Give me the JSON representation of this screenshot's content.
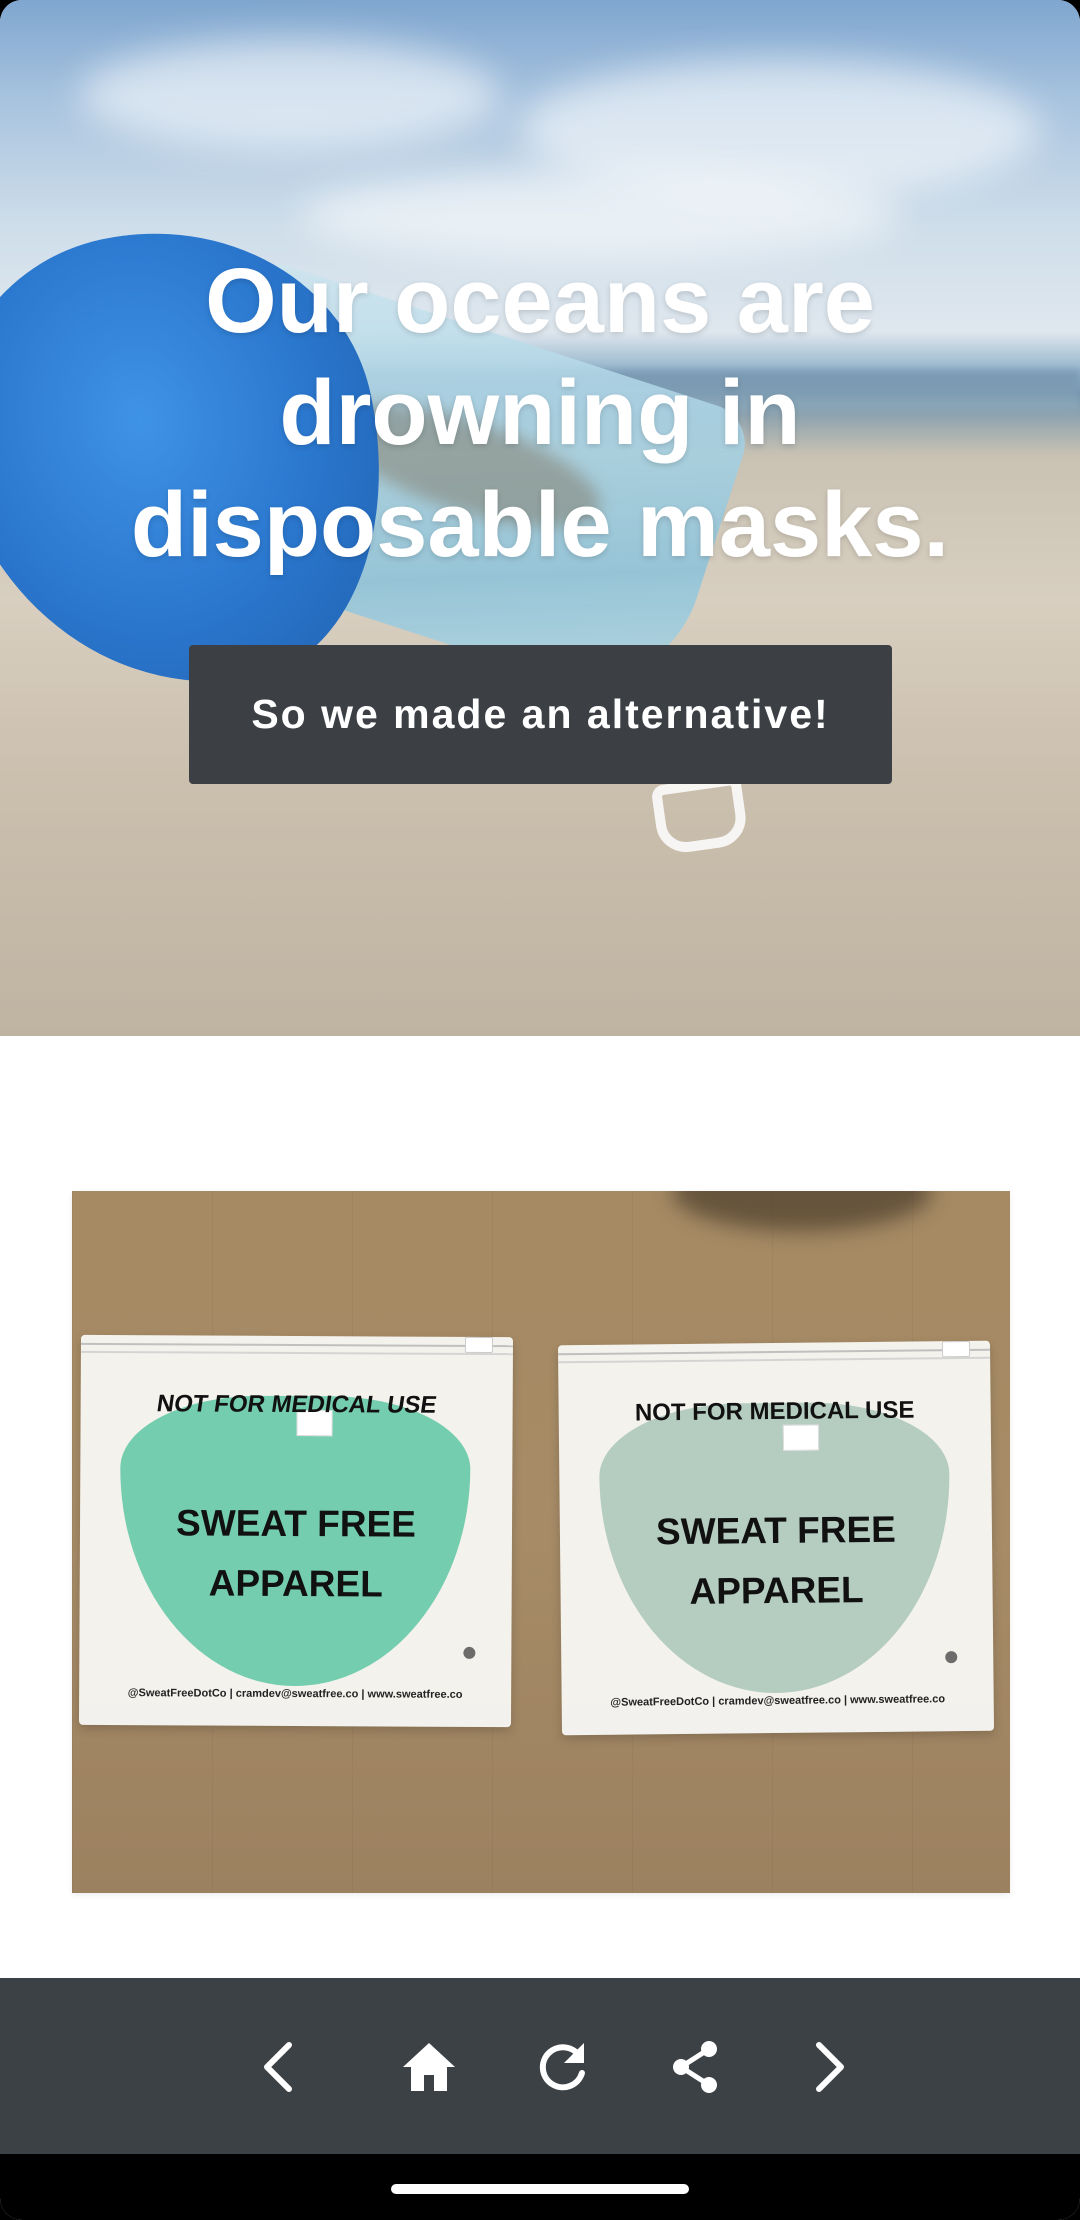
{
  "hero": {
    "title": "Our oceans are drowning in disposable masks.",
    "cta_label": "So we made an alternative!"
  },
  "product_photo": {
    "bags": [
      {
        "notice": "NOT FOR MEDICAL USE",
        "brand_line1": "SWEAT FREE",
        "brand_line2": "APPAREL",
        "contact": "@SweatFreeDotCo | cramdev@sweatfree.co | www.sweatfree.co",
        "mask_color": "#66c9a7"
      },
      {
        "notice": "NOT FOR MEDICAL USE",
        "brand_line1": "SWEAT FREE",
        "brand_line2": "APPAREL",
        "contact": "@SweatFreeDotCo | cramdev@sweatfree.co | www.sweatfree.co",
        "mask_color": "#a9c6b8"
      }
    ]
  },
  "nav_bar": {
    "background": "#3c4145",
    "items": [
      {
        "icon": "chevron-left-icon",
        "action": "back"
      },
      {
        "icon": "home-icon",
        "action": "home"
      },
      {
        "icon": "refresh-icon",
        "action": "reload"
      },
      {
        "icon": "share-icon",
        "action": "share"
      },
      {
        "icon": "chevron-right-icon",
        "action": "forward"
      }
    ]
  },
  "colors": {
    "cta_background": "#3c4045",
    "text_on_dark": "#ffffff"
  }
}
